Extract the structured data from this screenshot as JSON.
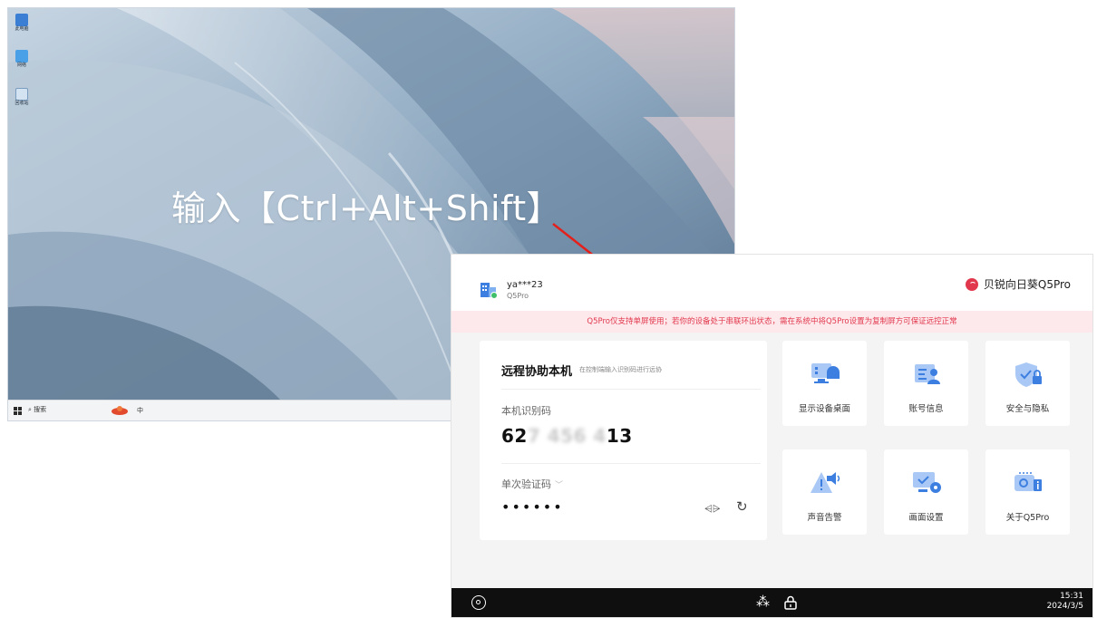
{
  "hint_text": "输入【Ctrl+Alt+Shift】",
  "desktop": {
    "icons": [
      {
        "label": "此电脑",
        "icon": "computer-icon"
      },
      {
        "label": "网络",
        "icon": "network-icon"
      },
      {
        "label": "回收站",
        "icon": "recycle-bin-icon"
      }
    ],
    "taskbar": {
      "search_label": "搜索",
      "extra_label": "中"
    }
  },
  "panel": {
    "user": "ya***23",
    "model": "Q5Pro",
    "brand": "贝锐向日葵Q5Pro",
    "notice": "Q5Pro仅支持单屏使用；若你的设备处于串联环出状态，需在系统中将Q5Pro设置为复制屏方可保证远控正常",
    "assist": {
      "title": "远程协助本机",
      "subtitle": "在控制端输入识别码进行远协",
      "code_label": "本机识别码",
      "code_prefix": "62",
      "code_hidden": "7 456 4",
      "code_suffix": "13",
      "otp_label": "单次验证码",
      "otp_value": "••••••"
    },
    "tiles": [
      {
        "label": "显示设备桌面",
        "icon": "display-desktop-icon"
      },
      {
        "label": "账号信息",
        "icon": "account-info-icon"
      },
      {
        "label": "安全与隐私",
        "icon": "security-privacy-icon"
      },
      {
        "label": "声音告警",
        "icon": "sound-alert-icon"
      },
      {
        "label": "画面设置",
        "icon": "display-settings-icon"
      },
      {
        "label": "关于Q5Pro",
        "icon": "about-icon"
      }
    ],
    "status": {
      "time": "15:31",
      "date": "2024/3/5"
    }
  },
  "colors": {
    "accent_red": "#e2384d",
    "notice_bg": "#fde9ec",
    "icon_blue": "#3d7fe0",
    "bar_dark": "#0f0f10"
  }
}
